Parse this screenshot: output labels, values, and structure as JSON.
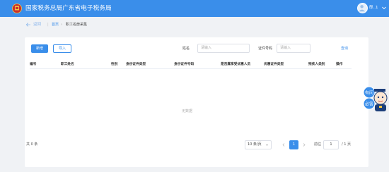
{
  "header": {
    "title": "国家税务总局广东省电子税务局",
    "user_name": "郎..1"
  },
  "breadcrumb": {
    "back": "返回",
    "separator": "|",
    "home": "首页",
    "arrow": "›",
    "current": "职工名册采集"
  },
  "toolbar": {
    "add_label": "新增",
    "import_label": "导入",
    "name_label": "姓名",
    "name_placeholder": "请输入",
    "id_label": "证件号码",
    "id_placeholder": "请输入",
    "search_label": "查询"
  },
  "table": {
    "columns": [
      "编号",
      "职工姓名",
      "性别",
      "身份证件类型",
      "身份证件号码",
      "是否属享受优惠人员",
      "优惠证件类型",
      "残疾人类别",
      "操作"
    ],
    "empty_text": "无数据"
  },
  "pagination": {
    "total_text": "共 0 条",
    "page_size": "10 条/页",
    "current_page": "1",
    "goto_label": "前往",
    "goto_value": "1",
    "total_pages": "/ 1 页"
  },
  "helper": {
    "text_top": "有问",
    "text_bottom": "必答"
  },
  "colors": {
    "brand_blue": "#3a8eea",
    "background": "#f0f2f5"
  },
  "icons": [
    "emblem-icon",
    "avatar-icon",
    "chevron-down-icon",
    "back-arrow-icon",
    "chevron-left-icon",
    "chevron-right-icon",
    "assistant-mascot-icon"
  ]
}
